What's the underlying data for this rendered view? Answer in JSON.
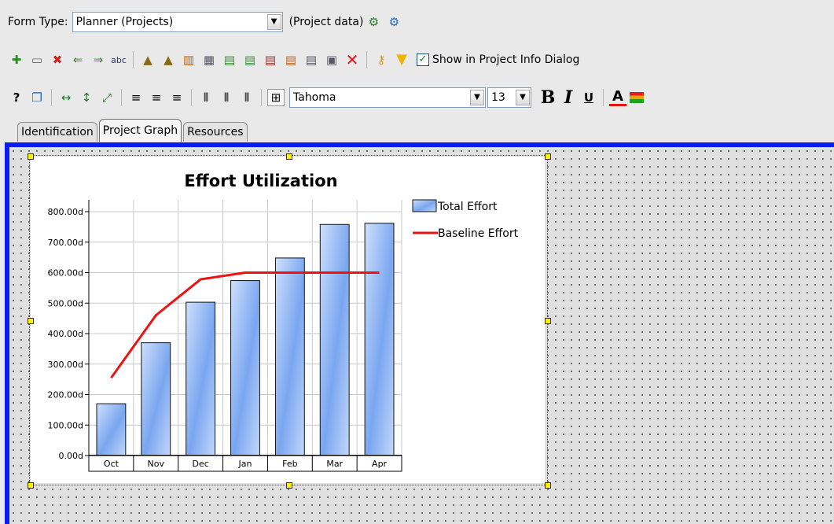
{
  "toolbar": {
    "form_type_label": "Form Type:",
    "form_type_value": "Planner (Projects)",
    "project_data_label": "(Project data)",
    "show_info_label": "Show in Project Info Dialog",
    "show_info_checked": true,
    "font_name": "Tahoma",
    "font_size": "13",
    "bold": "B",
    "italic": "I",
    "underline": "U",
    "font_color": "A"
  },
  "tabs": [
    {
      "label": "Identification",
      "active": false
    },
    {
      "label": "Project Graph",
      "active": true
    },
    {
      "label": "Resources",
      "active": false
    }
  ],
  "chart_data": {
    "type": "bar",
    "title": "Effort Utilization",
    "categories": [
      "Oct",
      "Nov",
      "Dec",
      "Jan",
      "Feb",
      "Mar",
      "Apr"
    ],
    "series": [
      {
        "name": "Total Effort",
        "type": "bar",
        "values": [
          170,
          370,
          503,
          574,
          648,
          758,
          762
        ],
        "color": "#7aa6f0"
      },
      {
        "name": "Baseline Effort",
        "type": "line",
        "values": [
          255,
          460,
          578,
          600,
          600,
          600,
          600
        ],
        "color": "#ee1111"
      }
    ],
    "yticks": [
      "0.00d",
      "100.00d",
      "200.00d",
      "300.00d",
      "400.00d",
      "500.00d",
      "600.00d",
      "700.00d",
      "800.00d"
    ],
    "ylim": [
      0,
      800
    ],
    "grid": true,
    "legend": "right"
  },
  "colors": {
    "canvas_border": "#0a1cf0",
    "handle": "#ffee00",
    "delete_icon": "#e21414",
    "filter_icon": "#f0b400"
  }
}
